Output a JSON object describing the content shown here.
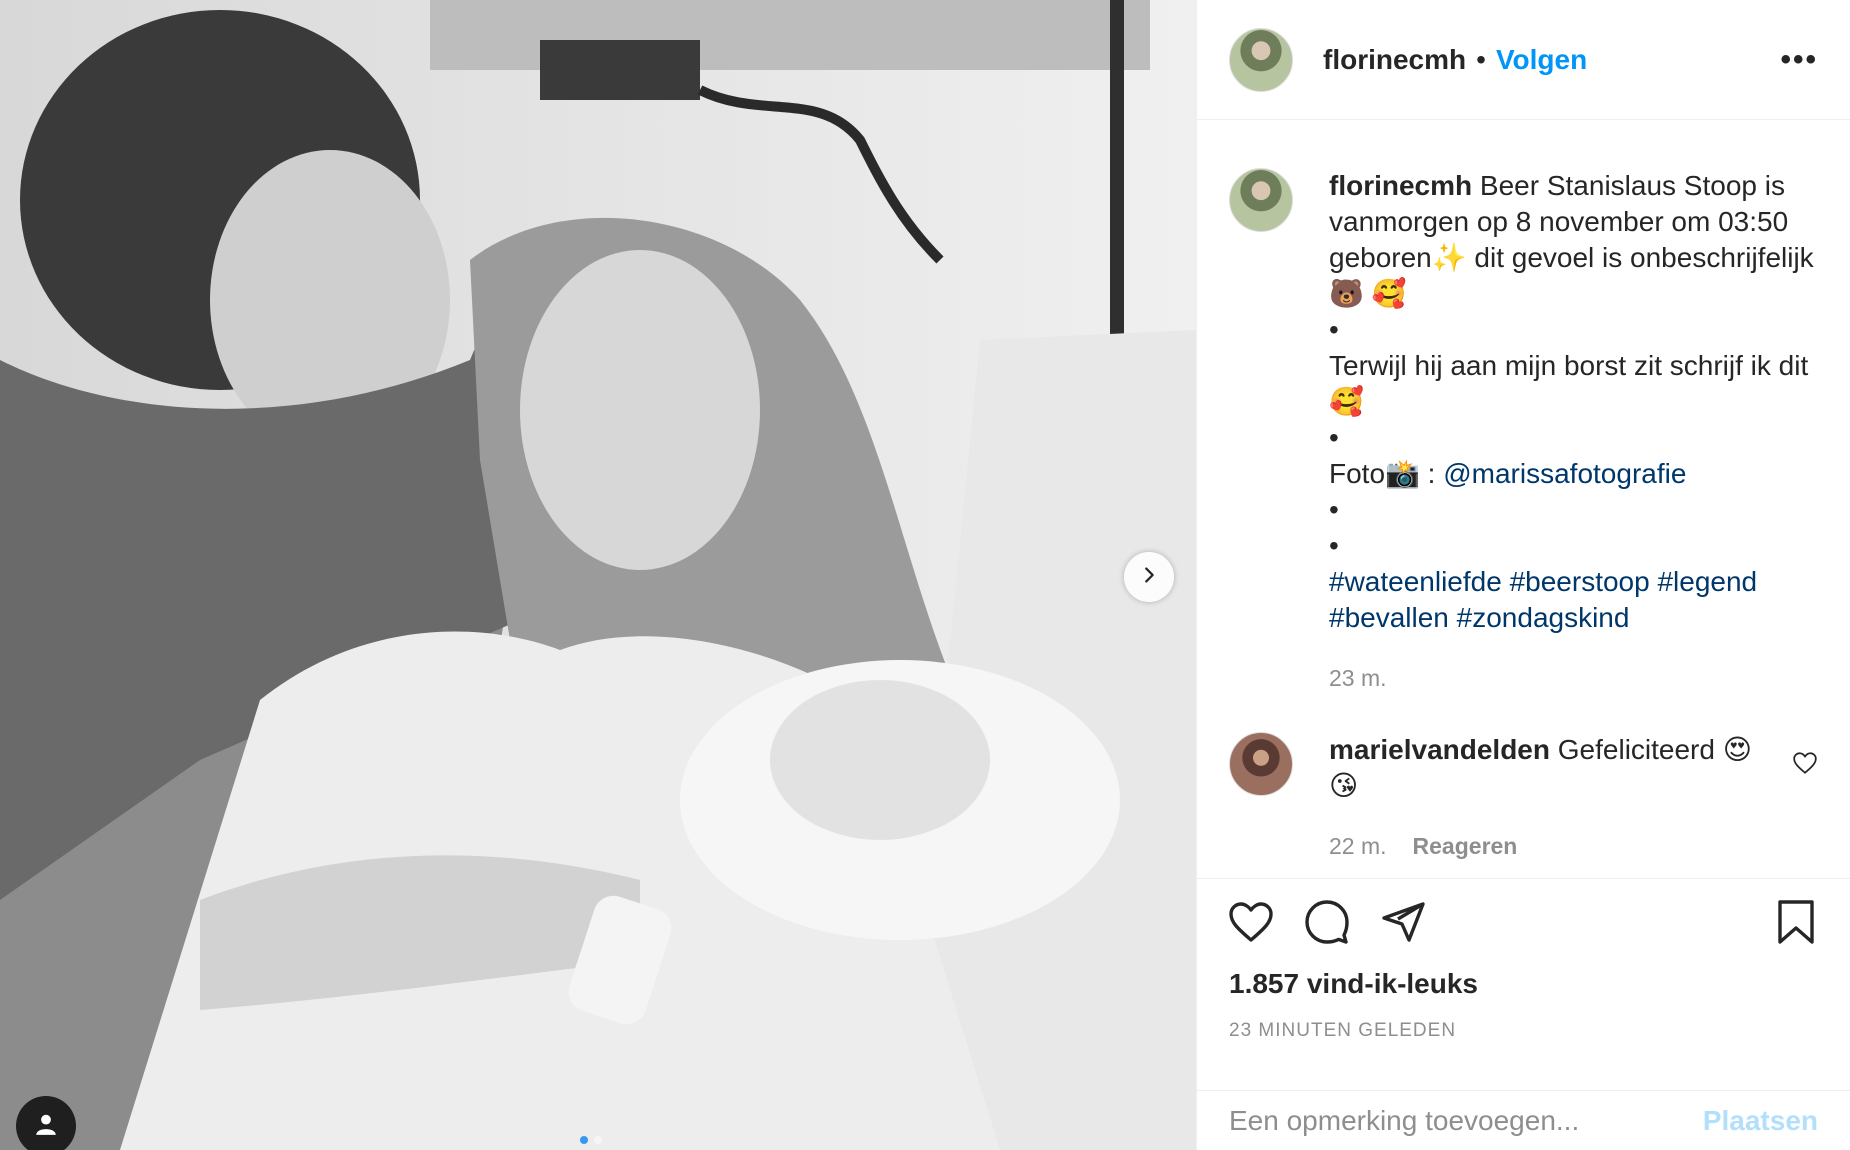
{
  "post": {
    "username": "florinecmh",
    "follow_label": "Volgen",
    "separator": "•",
    "more_label": "•••",
    "caption": {
      "username": "florinecmh",
      "line1": "Beer Stanislaus Stoop is vanmorgen op 8 november om 03:50 geboren✨  dit gevoel is onbeschrijfelijk 🐻 🥰",
      "bullet": "•",
      "line2": "Terwijl hij aan mijn borst zit schrijf ik dit 🥰",
      "photo_prefix": "Foto📸 : ",
      "photo_mention": "@marissafotografie",
      "hashtags": "#wateenliefde #beerstoop #legend #bevallen #zondagskind",
      "time": "23 m."
    },
    "comments": [
      {
        "username": "marielvandelden",
        "text": "Gefeliciteerd 😍 😘",
        "time": "22 m.",
        "reply_label": "Reageren"
      }
    ],
    "likes": "1.857 vind-ik-leuks",
    "timestamp": "23 MINUTEN GELEDEN",
    "add_comment_placeholder": "Een opmerking toevoegen...",
    "post_label": "Plaatsen"
  },
  "carousel": {
    "current": 1,
    "total": 2
  },
  "icons": {
    "like": "heart-icon",
    "comment": "comment-icon",
    "share": "share-icon",
    "save": "bookmark-icon",
    "next": "chevron-right-icon",
    "tag": "user-tag-icon"
  },
  "colors": {
    "accent": "#0095f6",
    "link": "#00376b",
    "muted": "#8e8e8e",
    "post_disabled": "#b2dffc"
  }
}
